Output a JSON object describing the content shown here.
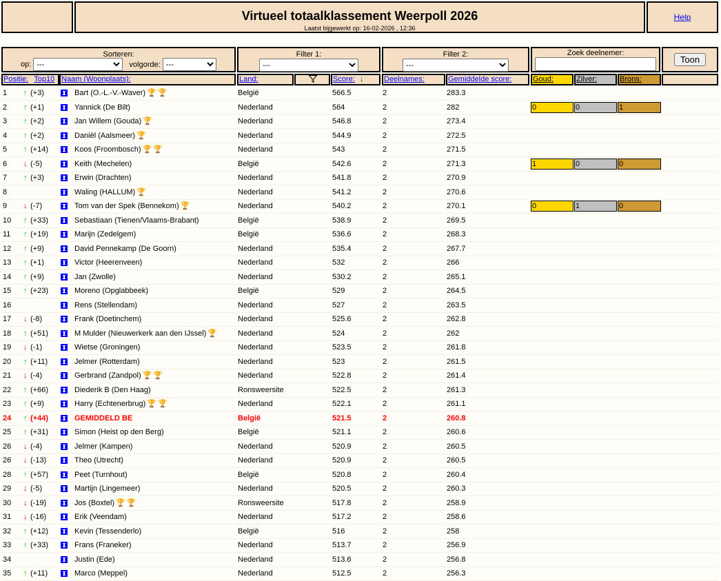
{
  "header": {
    "title": "Virtueel totaalklassement Weerpoll 2026",
    "updated": "Laatst bijgewerkt op: 16-02-2026 , 12:36",
    "help": "Help"
  },
  "controls": {
    "sort_label": "Sorteren:",
    "op_label": "op:",
    "op_value": "---",
    "order_label": "volgorde:",
    "order_value": "---",
    "filter1_label": "Filter 1:",
    "filter1_value": "---",
    "filter2_label": "Filter 2:",
    "filter2_value": "---",
    "search_label": "Zoek deelnemer:",
    "search_value": "",
    "show_button": "Toon"
  },
  "columns": {
    "position": "Positie:",
    "top10": "Top10",
    "name": "Naam (Woonplaats):",
    "country": "Land:",
    "score": "Score:",
    "entries": "Deelnames:",
    "avg": "Gemiddelde score:",
    "gold": "Goud:",
    "silver": "Zilver:",
    "bronze": "Brons:"
  },
  "colors": {
    "gold": "#ffd700",
    "silver": "#c0c0c0",
    "bronze": "#cd9a33",
    "header_bg": "#f5dfc4"
  },
  "rows": [
    {
      "pos": "1",
      "dir": "up",
      "chg": "(+3)",
      "name": "Bart (O.-L.-V.-Waver)",
      "trophies": [
        "gold",
        "gold"
      ],
      "land": "België",
      "score": "566.5",
      "n": "2",
      "avg": "283.3"
    },
    {
      "pos": "2",
      "dir": "up",
      "chg": "(+1)",
      "name": "Yannick (De Bilt)",
      "trophies": [],
      "land": "Nederland",
      "score": "564",
      "n": "2",
      "avg": "282",
      "medals": [
        "0",
        "0",
        "1"
      ]
    },
    {
      "pos": "3",
      "dir": "up",
      "chg": "(+2)",
      "name": "Jan Willem (Gouda)",
      "trophies": [
        "gold"
      ],
      "land": "Nederland",
      "score": "546.8",
      "n": "2",
      "avg": "273.4"
    },
    {
      "pos": "4",
      "dir": "up",
      "chg": "(+2)",
      "name": "Daniël (Aalsmeer)",
      "trophies": [
        "bronze"
      ],
      "land": "Nederland",
      "score": "544.9",
      "n": "2",
      "avg": "272.5"
    },
    {
      "pos": "5",
      "dir": "up",
      "chg": "(+14)",
      "name": "Koos (Froombosch)",
      "trophies": [
        "gold",
        "gold"
      ],
      "land": "Nederland",
      "score": "543",
      "n": "2",
      "avg": "271.5"
    },
    {
      "pos": "6",
      "dir": "down",
      "chg": "(-5)",
      "name": "Keith (Mechelen)",
      "trophies": [],
      "land": "België",
      "score": "542.6",
      "n": "2",
      "avg": "271.3",
      "medals": [
        "1",
        "0",
        "0"
      ]
    },
    {
      "pos": "7",
      "dir": "up",
      "chg": "(+3)",
      "name": "Erwin (Drachten)",
      "trophies": [],
      "land": "Nederland",
      "score": "541.8",
      "n": "2",
      "avg": "270.9"
    },
    {
      "pos": "8",
      "dir": "",
      "chg": "",
      "name": "Waling (HALLUM)",
      "trophies": [
        "bronze"
      ],
      "land": "Nederland",
      "score": "541.2",
      "n": "2",
      "avg": "270.6"
    },
    {
      "pos": "9",
      "dir": "down",
      "chg": "(-7)",
      "name": "Tom van der Spek (Bennekom)",
      "trophies": [
        "gold"
      ],
      "land": "Nederland",
      "score": "540.2",
      "n": "2",
      "avg": "270.1",
      "medals": [
        "0",
        "1",
        "0"
      ]
    },
    {
      "pos": "10",
      "dir": "up",
      "chg": "(+33)",
      "name": "Sebastiaan (Tienen/Vlaams-Brabant)",
      "trophies": [],
      "land": "België",
      "score": "538.9",
      "n": "2",
      "avg": "269.5"
    },
    {
      "pos": "11",
      "dir": "up",
      "chg": "(+19)",
      "name": "Marijn (Zedelgem)",
      "trophies": [],
      "land": "België",
      "score": "536.6",
      "n": "2",
      "avg": "268.3"
    },
    {
      "pos": "12",
      "dir": "up",
      "chg": "(+9)",
      "name": "David Pennekamp (De Goorn)",
      "trophies": [],
      "land": "Nederland",
      "score": "535.4",
      "n": "2",
      "avg": "267.7"
    },
    {
      "pos": "13",
      "dir": "up",
      "chg": "(+1)",
      "name": "Victor (Heerenveen)",
      "trophies": [],
      "land": "Nederland",
      "score": "532",
      "n": "2",
      "avg": "266"
    },
    {
      "pos": "14",
      "dir": "up",
      "chg": "(+9)",
      "name": "Jan (Zwolle)",
      "trophies": [],
      "land": "Nederland",
      "score": "530.2",
      "n": "2",
      "avg": "265.1"
    },
    {
      "pos": "15",
      "dir": "up",
      "chg": "(+23)",
      "name": "Moreno (Opglabbeek)",
      "trophies": [],
      "land": "België",
      "score": "529",
      "n": "2",
      "avg": "264.5"
    },
    {
      "pos": "16",
      "dir": "",
      "chg": "",
      "name": "Rens (Stellendam)",
      "trophies": [],
      "land": "Nederland",
      "score": "527",
      "n": "2",
      "avg": "263.5"
    },
    {
      "pos": "17",
      "dir": "down",
      "chg": "(-8)",
      "name": "Frank (Doetinchem)",
      "trophies": [],
      "land": "Nederland",
      "score": "525.6",
      "n": "2",
      "avg": "262.8"
    },
    {
      "pos": "18",
      "dir": "up",
      "chg": "(+51)",
      "name": "M Mulder (Nieuwerkerk aan den IJssel)",
      "trophies": [
        "gold"
      ],
      "land": "Nederland",
      "score": "524",
      "n": "2",
      "avg": "262"
    },
    {
      "pos": "19",
      "dir": "down",
      "chg": "(-1)",
      "name": "Wietse (Groningen)",
      "trophies": [],
      "land": "Nederland",
      "score": "523.5",
      "n": "2",
      "avg": "261.8"
    },
    {
      "pos": "20",
      "dir": "up",
      "chg": "(+11)",
      "name": "Jelmer (Rotterdam)",
      "trophies": [],
      "land": "Nederland",
      "score": "523",
      "n": "2",
      "avg": "261.5"
    },
    {
      "pos": "21",
      "dir": "down",
      "chg": "(-4)",
      "name": "Gerbrand (Zandpol)",
      "trophies": [
        "bronze",
        "bronze"
      ],
      "land": "Nederland",
      "score": "522.8",
      "n": "2",
      "avg": "261.4"
    },
    {
      "pos": "22",
      "dir": "up",
      "chg": "(+66)",
      "name": "Diederik B (Den Haag)",
      "trophies": [],
      "land": "Ronsweersite",
      "score": "522.5",
      "n": "2",
      "avg": "261.3"
    },
    {
      "pos": "23",
      "dir": "up",
      "chg": "(+9)",
      "name": "Harry (Echtenerbrug)",
      "trophies": [
        "gold",
        "silver"
      ],
      "land": "Nederland",
      "score": "522.1",
      "n": "2",
      "avg": "261.1"
    },
    {
      "pos": "24",
      "dir": "up",
      "chg": "(+44)",
      "name": "GEMIDDELD BE",
      "trophies": [],
      "land": "België",
      "score": "521.5",
      "n": "2",
      "avg": "260.8",
      "highlight": true
    },
    {
      "pos": "25",
      "dir": "up",
      "chg": "(+31)",
      "name": "Simon (Heist op den Berg)",
      "trophies": [],
      "land": "België",
      "score": "521.1",
      "n": "2",
      "avg": "260.6"
    },
    {
      "pos": "26",
      "dir": "down",
      "chg": "(-4)",
      "name": "Jelmer (Kampen)",
      "trophies": [],
      "land": "Nederland",
      "score": "520.9",
      "n": "2",
      "avg": "260.5"
    },
    {
      "pos": "26",
      "dir": "down",
      "chg": "(-13)",
      "name": "Theo (Utrecht)",
      "trophies": [],
      "land": "Nederland",
      "score": "520.9",
      "n": "2",
      "avg": "260.5"
    },
    {
      "pos": "28",
      "dir": "up",
      "chg": "(+57)",
      "name": "Peet (Turnhout)",
      "trophies": [],
      "land": "België",
      "score": "520.8",
      "n": "2",
      "avg": "260.4"
    },
    {
      "pos": "29",
      "dir": "down",
      "chg": "(-5)",
      "name": "Martijn (Lingemeer)",
      "trophies": [],
      "land": "Nederland",
      "score": "520.5",
      "n": "2",
      "avg": "260.3"
    },
    {
      "pos": "30",
      "dir": "down",
      "chg": "(-19)",
      "name": "Jos (Boxtel)",
      "trophies": [
        "gold",
        "bronze"
      ],
      "land": "Ronsweersite",
      "score": "517.8",
      "n": "2",
      "avg": "258.9"
    },
    {
      "pos": "31",
      "dir": "down",
      "chg": "(-16)",
      "name": "Erik (Veendam)",
      "trophies": [],
      "land": "Nederland",
      "score": "517.2",
      "n": "2",
      "avg": "258.6"
    },
    {
      "pos": "32",
      "dir": "up",
      "chg": "(+12)",
      "name": "Kevin (Tessenderlo)",
      "trophies": [],
      "land": "België",
      "score": "516",
      "n": "2",
      "avg": "258"
    },
    {
      "pos": "33",
      "dir": "up",
      "chg": "(+33)",
      "name": "Frans (Franeker)",
      "trophies": [],
      "land": "Nederland",
      "score": "513.7",
      "n": "2",
      "avg": "256.9"
    },
    {
      "pos": "34",
      "dir": "",
      "chg": "",
      "name": "Justin (Ede)",
      "trophies": [],
      "land": "Nederland",
      "score": "513.6",
      "n": "2",
      "avg": "256.8"
    },
    {
      "pos": "35",
      "dir": "up",
      "chg": "(+11)",
      "name": "Marco (Meppel)",
      "trophies": [],
      "land": "Nederland",
      "score": "512.5",
      "n": "2",
      "avg": "256.3"
    }
  ]
}
